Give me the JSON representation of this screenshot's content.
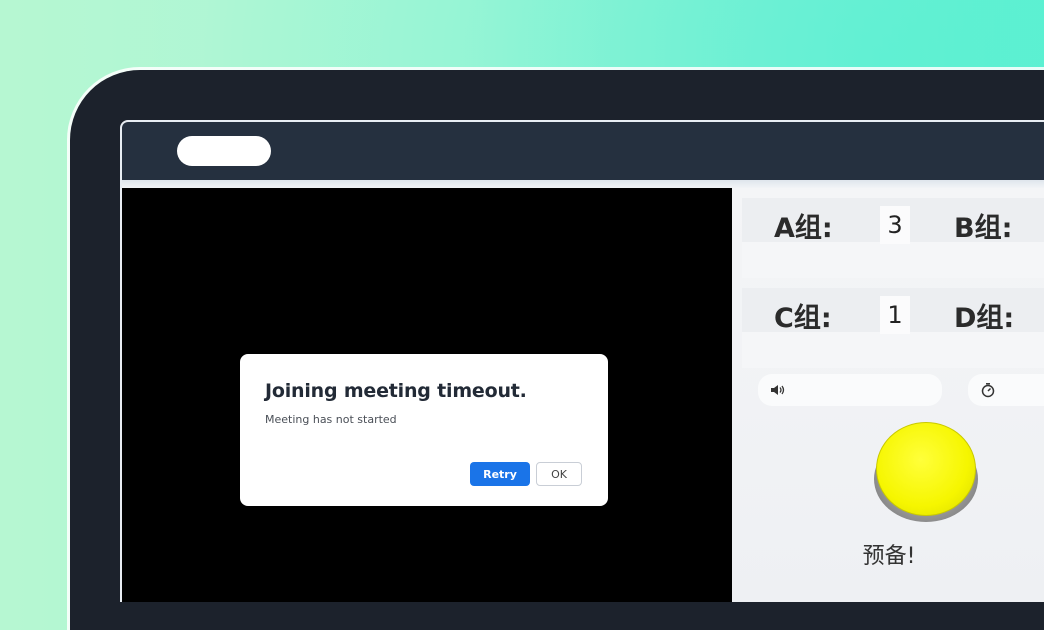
{
  "dialog": {
    "title": "Joining meeting timeout.",
    "message": "Meeting has not started",
    "retry_label": "Retry",
    "ok_label": "OK",
    "accent_color": "#1a74e8"
  },
  "scoreboard": {
    "groups": [
      {
        "label": "A组:",
        "value": "3"
      },
      {
        "label": "B组:",
        "value": ""
      },
      {
        "label": "C组:",
        "value": "1"
      },
      {
        "label": "D组:",
        "value": ""
      }
    ]
  },
  "controls": {
    "volume_icon": "speaker-icon",
    "timer_icon": "stopwatch-icon"
  },
  "buzzer": {
    "label": "预备!",
    "color": "#f7f700"
  }
}
